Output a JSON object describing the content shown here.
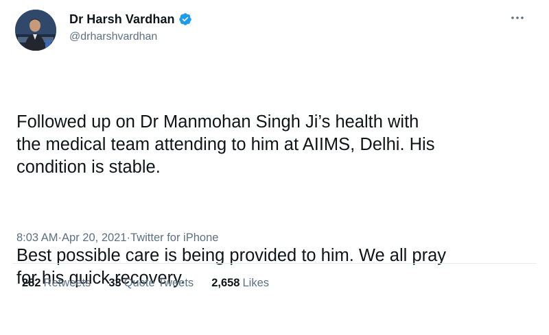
{
  "author": {
    "display_name": "Dr Harsh Vardhan",
    "handle": "@drharshvardhan",
    "verified": true
  },
  "icons": {
    "verified": "verified-badge-icon",
    "more": "more-options-icon",
    "accent": "#1d9bf0"
  },
  "tweet": {
    "paragraphs": [
      "Followed up on Dr Manmohan Singh Ji’s health with\nthe medical team attending to him at AIIMS, Delhi. His\ncondition is stable.",
      "Best possible care is being provided to him. We all pray\nfor his quick recovery."
    ],
    "time": "8:03 AM",
    "separator": " · ",
    "date": "Apr 20, 2021",
    "source": "Twitter for iPhone"
  },
  "stats": [
    {
      "count": "282",
      "label": "Retweets"
    },
    {
      "count": "33",
      "label": "Quote Tweets"
    },
    {
      "count": "2,658",
      "label": "Likes"
    }
  ]
}
